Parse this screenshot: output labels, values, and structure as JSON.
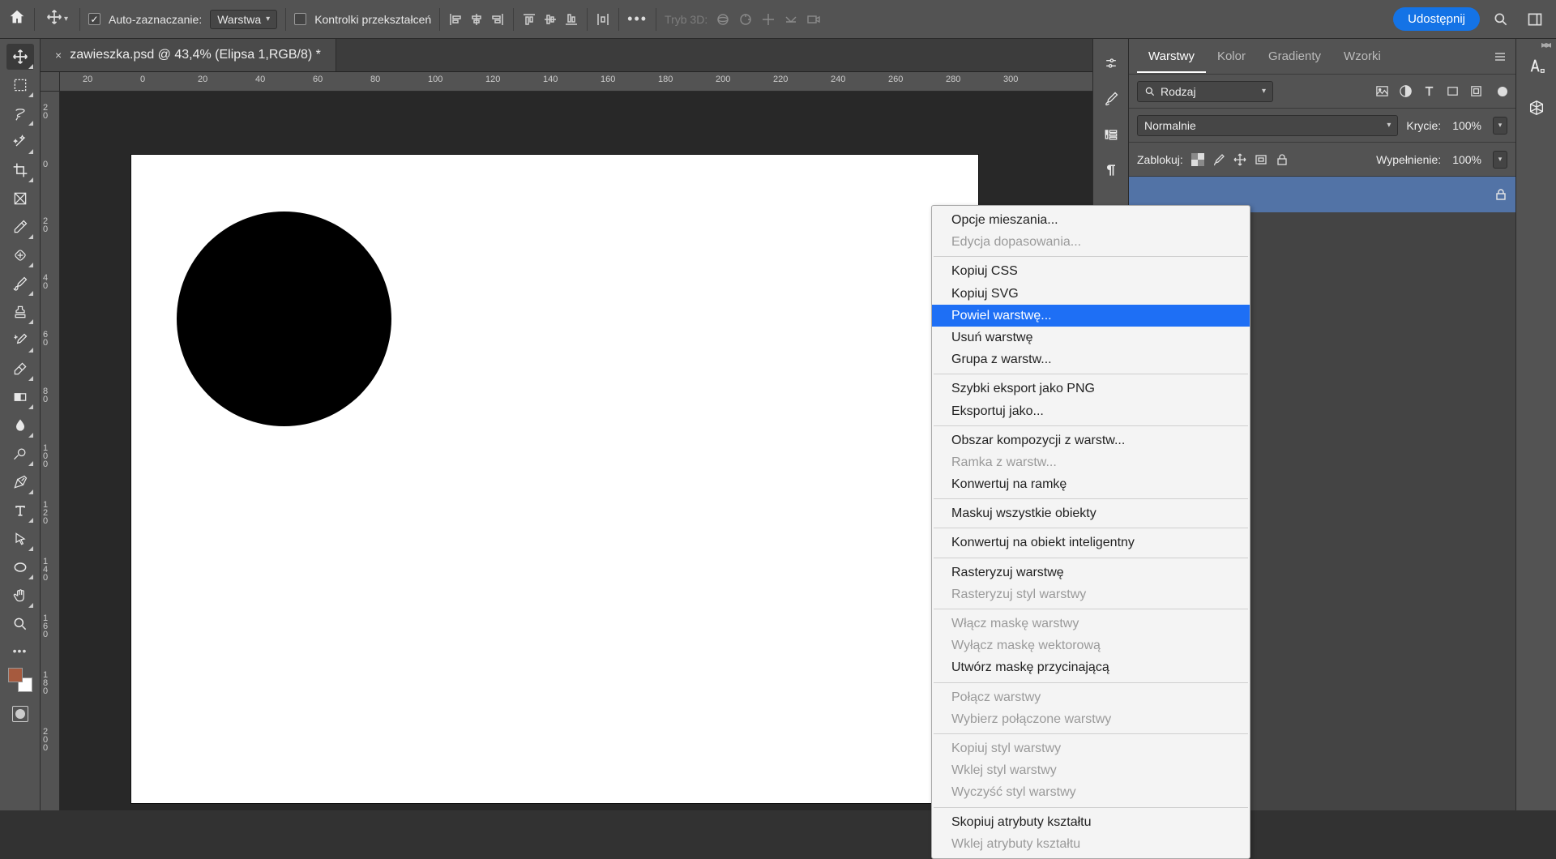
{
  "topbar": {
    "auto_select_label": "Auto-zaznaczanie:",
    "target_dropdown": "Warstwa",
    "transform_controls_label": "Kontrolki przekształceń",
    "mode3d_label": "Tryb 3D:",
    "share_label": "Udostępnij"
  },
  "document": {
    "tab_title": "zawieszka.psd @ 43,4% (Elipsa 1,RGB/8) *"
  },
  "ruler_h": [
    "20",
    "0",
    "20",
    "40",
    "60",
    "80",
    "100",
    "120",
    "140",
    "160",
    "180",
    "200",
    "220",
    "240",
    "260",
    "280",
    "300"
  ],
  "ruler_v": [
    "20",
    "0",
    "20",
    "40",
    "60",
    "80",
    "100",
    "120",
    "140",
    "160",
    "180",
    "200"
  ],
  "panels": {
    "tabs": {
      "layers": "Warstwy",
      "color": "Kolor",
      "gradients": "Gradienty",
      "patterns": "Wzorki"
    },
    "filter_dd": "Rodzaj",
    "blend_mode": "Normalnie",
    "opacity_label": "Krycie:",
    "opacity_value": "100%",
    "lock_label": "Zablokuj:",
    "fill_label": "Wypełnienie:",
    "fill_value": "100%"
  },
  "swatch_fg": "#a65a3e",
  "context_menu": {
    "group1": [
      {
        "label": "Opcje mieszania...",
        "disabled": false
      },
      {
        "label": "Edycja dopasowania...",
        "disabled": true
      }
    ],
    "group2": [
      {
        "label": "Kopiuj CSS",
        "disabled": false
      },
      {
        "label": "Kopiuj SVG",
        "disabled": false
      },
      {
        "label": "Powiel warstwę...",
        "disabled": false,
        "highlight": true
      },
      {
        "label": "Usuń warstwę",
        "disabled": false
      },
      {
        "label": "Grupa z warstw...",
        "disabled": false
      }
    ],
    "group3": [
      {
        "label": "Szybki eksport jako PNG",
        "disabled": false
      },
      {
        "label": "Eksportuj jako...",
        "disabled": false
      }
    ],
    "group4": [
      {
        "label": "Obszar kompozycji z warstw...",
        "disabled": false
      },
      {
        "label": "Ramka z warstw...",
        "disabled": true
      },
      {
        "label": "Konwertuj na ramkę",
        "disabled": false
      }
    ],
    "group5": [
      {
        "label": "Maskuj wszystkie obiekty",
        "disabled": false
      }
    ],
    "group6": [
      {
        "label": "Konwertuj na obiekt inteligentny",
        "disabled": false
      }
    ],
    "group7": [
      {
        "label": "Rasteryzuj warstwę",
        "disabled": false
      },
      {
        "label": "Rasteryzuj styl warstwy",
        "disabled": true
      }
    ],
    "group8": [
      {
        "label": "Włącz maskę warstwy",
        "disabled": true
      },
      {
        "label": "Wyłącz maskę wektorową",
        "disabled": true
      },
      {
        "label": "Utwórz maskę przycinającą",
        "disabled": false
      }
    ],
    "group9": [
      {
        "label": "Połącz warstwy",
        "disabled": true
      },
      {
        "label": "Wybierz połączone warstwy",
        "disabled": true
      }
    ],
    "group10": [
      {
        "label": "Kopiuj styl warstwy",
        "disabled": true
      },
      {
        "label": "Wklej styl warstwy",
        "disabled": true
      },
      {
        "label": "Wyczyść styl warstwy",
        "disabled": true
      }
    ],
    "group11": [
      {
        "label": "Skopiuj atrybuty kształtu",
        "disabled": false
      },
      {
        "label": "Wklej atrybuty kształtu",
        "disabled": true
      }
    ]
  }
}
